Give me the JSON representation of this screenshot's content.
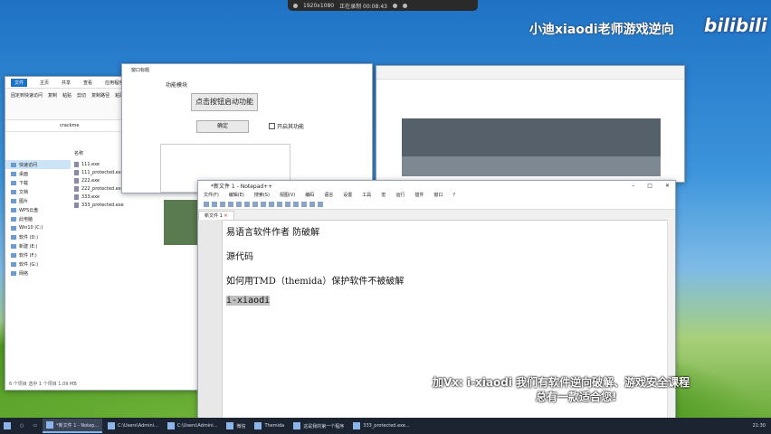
{
  "recorder": {
    "resolution": "1920x1080",
    "status": "正在录制 00:08:43"
  },
  "watermark": {
    "channel": "小迪xiaodi老师游戏逆向",
    "logo": "bilibili"
  },
  "explorer": {
    "tabs": [
      "文件",
      "主页",
      "共享",
      "查看",
      "应用程序工具"
    ],
    "ribbon_items": [
      "固定到快速访问",
      "复制",
      "粘贴",
      "剪切",
      "复制路径",
      "粘贴快捷方式"
    ],
    "breadcrumb": "crackme",
    "nav": [
      "快速访问",
      "桌面",
      "下载",
      "文档",
      "图片",
      "WPS云盘",
      "此电脑",
      "Win10 (C:)",
      "软件 (D:)",
      "新建 (E:)",
      "软件 (F:)",
      "软件 (G:)",
      "网络"
    ],
    "column_header": "名称",
    "files": [
      "111.exe",
      "111_protected.exe",
      "222.exe",
      "222_protected.exe",
      "333.exe",
      "333_protected.exe"
    ],
    "status": "6 个项目   选中 1 个项目 1.09 MB"
  },
  "dialog": {
    "title": "窗口标题",
    "group": "功能模块",
    "start_button": "点击按钮启动功能",
    "ok_button": "确定",
    "checkbox": "开启其功能"
  },
  "npp": {
    "title": "*新文件 1 - Notepad++",
    "menu": [
      "文件(F)",
      "编辑(E)",
      "搜索(S)",
      "视图(V)",
      "编码",
      "语言",
      "设置",
      "工具",
      "宏",
      "运行",
      "插件",
      "窗口",
      "?"
    ],
    "tab": "新文件 1",
    "lines": [
      "易语言软件作者 防破解",
      "源代码",
      "如何用TMD（themida）保护软件不被破解",
      "i-xiaodi"
    ]
  },
  "overlay": {
    "line1": "加Vx: i-xiaodi 我们有软件逆向破解、游戏安全课程",
    "line2": "总有一款适合您!"
  },
  "taskbar": {
    "items": [
      "*新文件 1 - Notep...",
      "C:\\Users\\Admini...",
      "C:\\Users\\Admini...",
      "微信",
      "Themida",
      "这是我的第一个程序",
      "333_protected.exe..."
    ],
    "time": "21:30"
  }
}
